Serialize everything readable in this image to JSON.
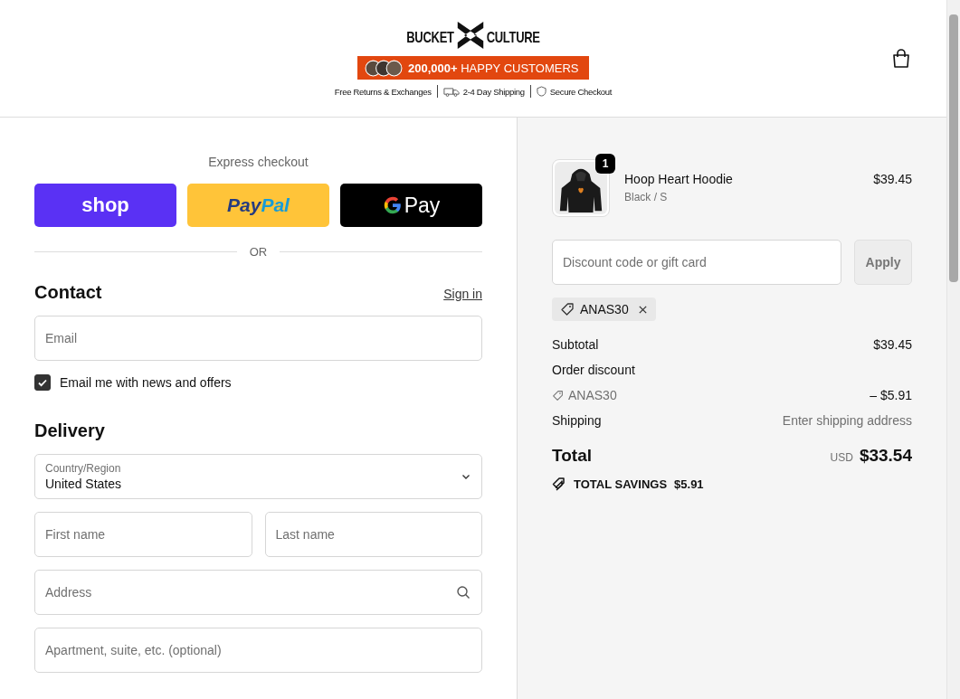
{
  "header": {
    "logo": {
      "left": "BUCKET",
      "right": "CULTURE"
    },
    "banner": "**200,000+** HAPPY CUSTOMERS",
    "trust": [
      {
        "kind": "plain",
        "label": "Free Returns & Exchanges"
      },
      {
        "kind": "truck",
        "label": "2-4 Day Shipping"
      },
      {
        "kind": "shield",
        "label": "Secure Checkout"
      }
    ]
  },
  "express": {
    "title": "Express checkout",
    "buttons": [
      {
        "kind": "shop",
        "parts": [
          "shop"
        ]
      },
      {
        "kind": "paypal",
        "parts": [
          "Pay",
          "Pal"
        ]
      },
      {
        "kind": "gpay",
        "parts": [
          "Pay"
        ]
      }
    ],
    "divider": "OR"
  },
  "contact": {
    "heading": "Contact",
    "sign_in": "Sign in",
    "email": {
      "placeholder": "Email"
    },
    "newsletter": {
      "label": "Email me with news and offers",
      "checked": true
    }
  },
  "delivery": {
    "heading": "Delivery",
    "country": {
      "label": "Country/Region",
      "value": "United States"
    },
    "rows": [
      [
        {
          "placeholder": "First name"
        },
        {
          "placeholder": "Last name"
        }
      ],
      [
        {
          "placeholder": "Address",
          "kind": "search"
        }
      ],
      [
        {
          "placeholder": "Apartment, suite, etc. (optional)"
        }
      ]
    ]
  },
  "summary": {
    "item": {
      "name": "Hoop Heart Hoodie",
      "variant": "Black / S",
      "price": "$39.45",
      "quantity": "1"
    },
    "discount": {
      "placeholder": "Discount code or gift card",
      "button": "Apply"
    },
    "applied_code": "ANAS30",
    "lines": [
      {
        "kind": "plain",
        "label": "Subtotal",
        "value": "$39.45"
      },
      {
        "kind": "plain",
        "label": "Order discount"
      },
      {
        "kind": "code",
        "label": "ANAS30",
        "value": "– $5.91"
      },
      {
        "kind": "muted",
        "label": "Shipping",
        "value": "Enter shipping address"
      }
    ],
    "total": {
      "label": "Total",
      "currency": "USD",
      "value": "$33.54"
    },
    "savings": {
      "label": "TOTAL SAVINGS",
      "value": "$5.91"
    }
  }
}
